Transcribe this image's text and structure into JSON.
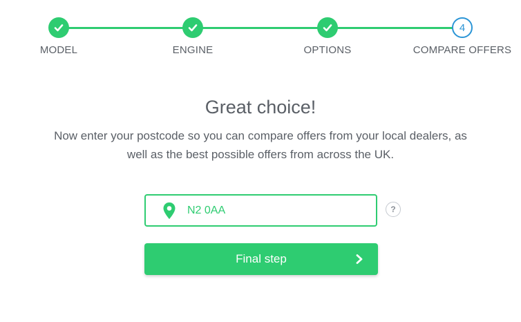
{
  "stepper": {
    "steps": [
      {
        "label": "MODEL",
        "state": "done",
        "icon": "check-icon"
      },
      {
        "label": "ENGINE",
        "state": "done",
        "icon": "check-icon"
      },
      {
        "label": "OPTIONS",
        "state": "done",
        "icon": "check-icon"
      },
      {
        "label": "COMPARE OFFERS",
        "state": "current",
        "number": "4"
      }
    ]
  },
  "main": {
    "headline": "Great choice!",
    "subtext": "Now enter your postcode so you can compare offers from your local dealers, as well as the best possible offers from across the UK."
  },
  "postcode": {
    "value": "N2 0AA",
    "icon": "location-pin-icon",
    "help_label": "?"
  },
  "cta": {
    "label": "Final step",
    "icon": "chevron-right-icon"
  },
  "colors": {
    "accent": "#2ecc71",
    "current_step": "#2b95d6",
    "text": "#5a5f66"
  }
}
